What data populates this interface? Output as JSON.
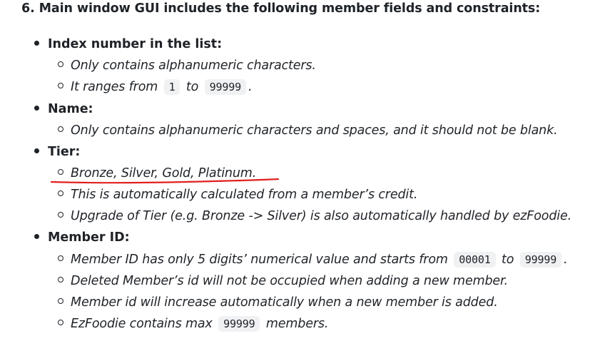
{
  "heading": "6. Main window GUI includes the following member fields and constraints:",
  "sections": [
    {
      "title": "Index number in the list:",
      "items": [
        {
          "text": "Only contains alphanumeric characters."
        },
        {
          "pre": "It ranges from",
          "code1": "1",
          "mid": "to",
          "code2": "99999",
          "post": "."
        }
      ]
    },
    {
      "title": "Name:",
      "items": [
        {
          "text": "Only contains alphanumeric characters and spaces, and it should not be blank."
        }
      ]
    },
    {
      "title": "Tier:",
      "items": [
        {
          "text": "Bronze, Silver, Gold, Platinum."
        },
        {
          "text": "This is automatically calculated from a member’s credit."
        },
        {
          "text": "Upgrade of Tier (e.g. Bronze -> Silver) is also automatically handled by ezFoodie."
        }
      ]
    },
    {
      "title": "Member ID:",
      "items": [
        {
          "pre": "Member ID has only 5 digits’ numerical value and starts from",
          "code1": "00001",
          "mid": "to",
          "code2": "99999",
          "post": "."
        },
        {
          "text": "Deleted Member’s id will not be occupied when adding a new member."
        },
        {
          "text": "Member id will increase automatically when a new member is added."
        },
        {
          "pre": "EzFoodie contains max",
          "code1": "99999",
          "post": "members."
        }
      ]
    }
  ],
  "annotation_color": "#e0201f"
}
